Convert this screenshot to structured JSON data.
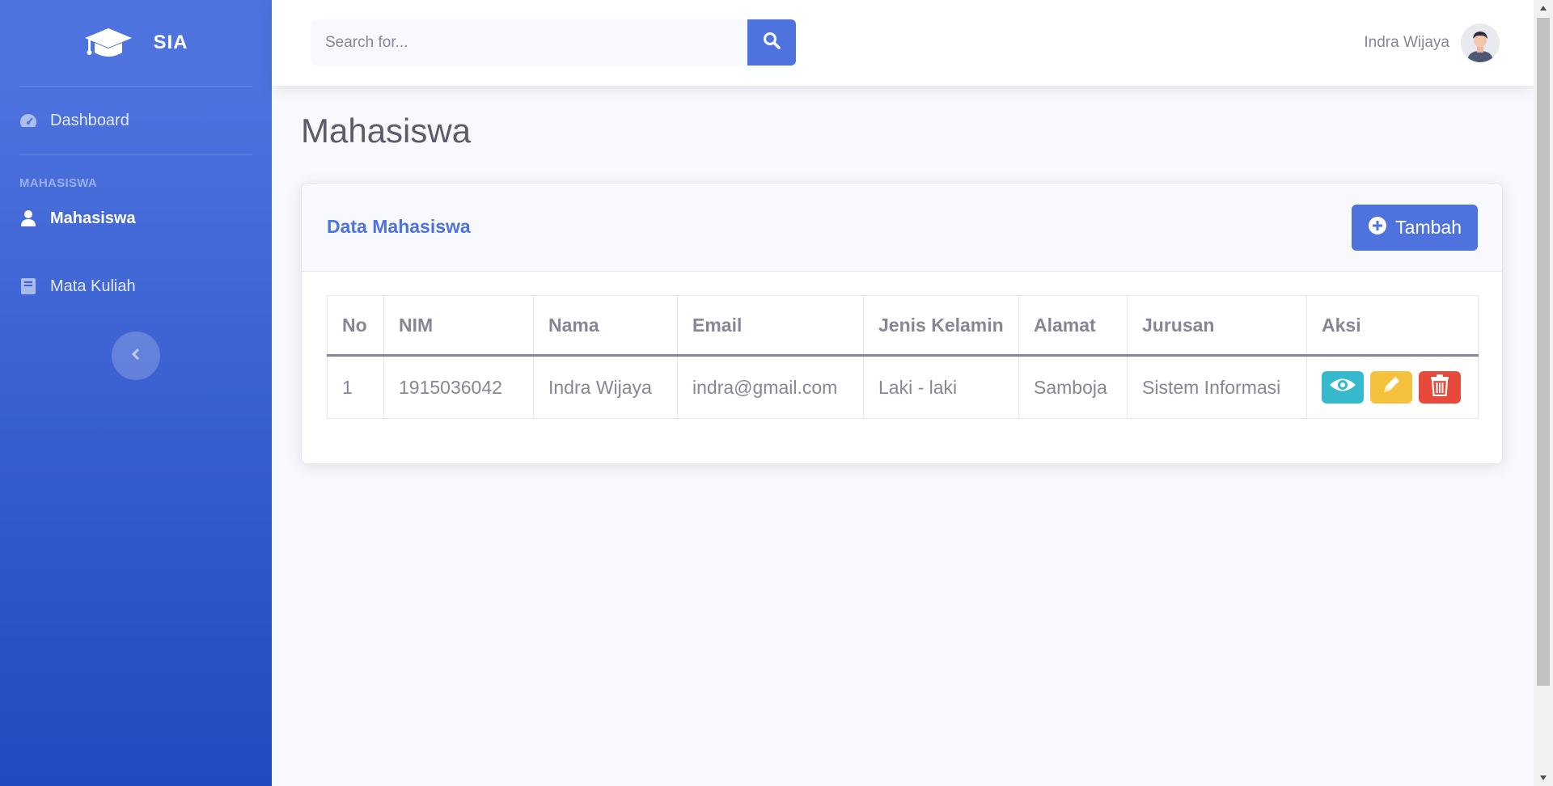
{
  "sidebar": {
    "brand": "SIA",
    "dashboard_label": "Dashboard",
    "heading": "MAHASISWA",
    "items": [
      {
        "label": "Mahasiswa"
      },
      {
        "label": "Mata Kuliah"
      }
    ]
  },
  "topbar": {
    "search_placeholder": "Search for...",
    "user_name": "Indra Wijaya"
  },
  "main": {
    "page_title": "Mahasiswa",
    "card_title": "Data Mahasiswa",
    "add_button_label": "Tambah",
    "table": {
      "headers": [
        "No",
        "NIM",
        "Nama",
        "Email",
        "Jenis Kelamin",
        "Alamat",
        "Jurusan",
        "Aksi"
      ],
      "rows": [
        {
          "no": "1",
          "nim": "1915036042",
          "nama": "Indra Wijaya",
          "email": "indra@gmail.com",
          "jenis_kelamin": "Laki - laki",
          "alamat": "Samboja",
          "jurusan": "Sistem Informasi"
        }
      ]
    }
  },
  "colors": {
    "primary": "#4e73df",
    "info": "#36b9cc",
    "warning": "#f6c23e",
    "danger": "#e74a3b"
  },
  "icons": {
    "brand": "graduation-cap-icon",
    "dashboard": "tachometer-icon",
    "mahasiswa": "user-icon",
    "mata_kuliah": "book-icon",
    "search": "search-icon",
    "add": "plus-circle-icon",
    "view": "eye-icon",
    "edit": "pencil-icon",
    "delete": "trash-icon"
  }
}
